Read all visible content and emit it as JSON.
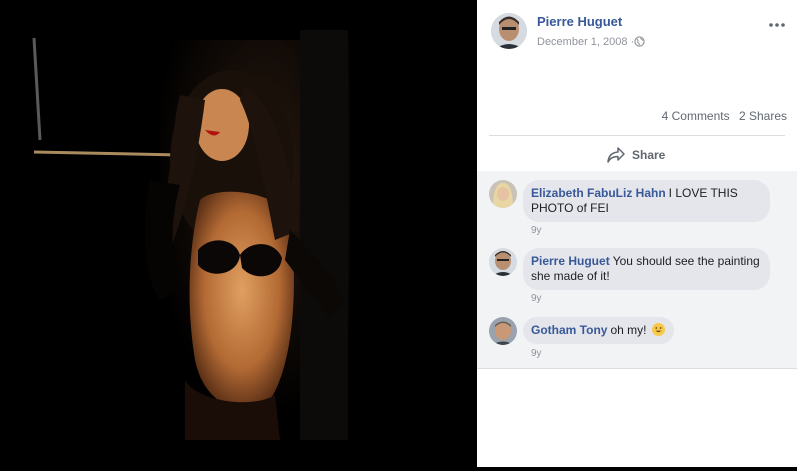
{
  "post": {
    "author": "Pierre Huguet",
    "date": "December 1, 2008",
    "separator": "·",
    "more_icon": "more-horizontal-icon",
    "privacy_icon": "globe-icon",
    "comments_count": "4 Comments",
    "shares_count": "2 Shares",
    "share_label": "Share",
    "share_icon": "share-arrow-icon"
  },
  "comments": [
    {
      "author": "Elizabeth FabuLiz Hahn",
      "text": "I LOVE THIS PHOTO of FEI",
      "time": "9y"
    },
    {
      "author": "Pierre Huguet",
      "text": "You should see the painting she made of it!",
      "time": "9y"
    },
    {
      "author": "Gotham Tony",
      "text": "oh my!",
      "time": "9y",
      "emoji": "smiley-emoji-icon"
    }
  ],
  "colors": {
    "link_blue": "#385898",
    "meta_gray": "#90949c",
    "comment_bg": "#f2f3f5",
    "bubble_bg": "#e4e6eb"
  }
}
